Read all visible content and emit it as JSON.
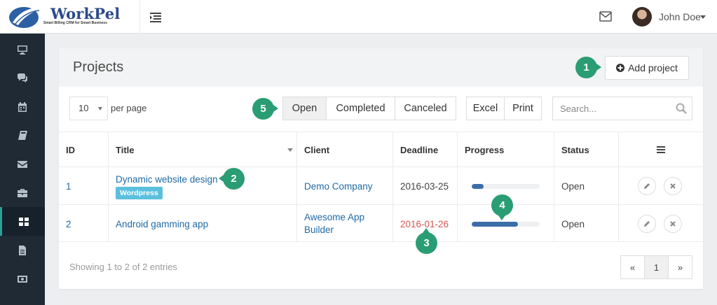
{
  "brand": {
    "name": "WorkPel",
    "tagline": "Smart Billing CRM for Smart Business"
  },
  "user": {
    "name": "John Doe"
  },
  "page": {
    "title": "Projects",
    "add_button": "Add project"
  },
  "table_controls": {
    "per_page_value": "10",
    "per_page_label": "per page",
    "filters": [
      "Open",
      "Completed",
      "Canceled"
    ],
    "active_filter": "Open",
    "export": [
      "Excel",
      "Print"
    ],
    "search_placeholder": "Search..."
  },
  "columns": [
    "ID",
    "Title",
    "Client",
    "Deadline",
    "Progress",
    "Status"
  ],
  "rows": [
    {
      "id": "1",
      "title": "Dynamic website design",
      "tag": "Wordpress",
      "client": "Demo Company",
      "deadline": "2016-03-25",
      "deadline_overdue": false,
      "progress": 0.18,
      "status": "Open"
    },
    {
      "id": "2",
      "title": "Android gamming app",
      "tag": "",
      "client": "Awesome App Builder",
      "deadline": "2016-01-26",
      "deadline_overdue": true,
      "progress": 0.68,
      "status": "Open"
    }
  ],
  "footer": {
    "showing": "Showing 1 to 2 of 2 entries",
    "prev": "«",
    "page": "1",
    "next": "»"
  },
  "callouts": [
    "1",
    "2",
    "3",
    "4",
    "5"
  ],
  "colors": {
    "accent": "#2a9d74",
    "link": "#1f6aa5",
    "overdue": "#d9534f",
    "progress": "#3b6da8",
    "sidebar": "#1f2a35"
  },
  "sidebar_icons": [
    "monitor-icon",
    "chat-icon",
    "calendar-icon",
    "book-icon",
    "mail-icon",
    "briefcase-icon",
    "grid-icon",
    "document-icon",
    "money-icon"
  ]
}
